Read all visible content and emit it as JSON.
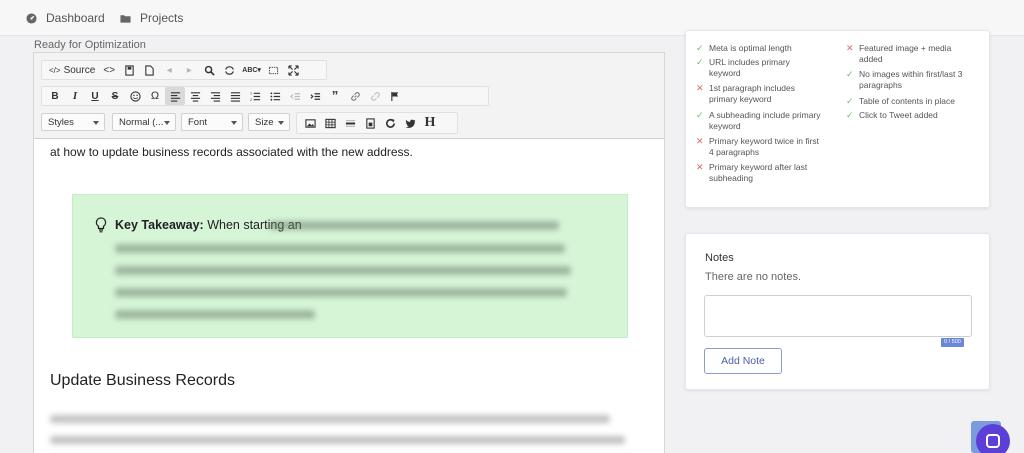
{
  "nav": {
    "dashboard": "Dashboard",
    "projects": "Projects"
  },
  "editor": {
    "status_label": "Ready for Optimization",
    "toolbar": {
      "source_label": "Source",
      "styles_label": "Styles",
      "format_label": "Normal (...",
      "font_label": "Font",
      "size_label": "Size"
    },
    "intro_text": "at how to update business records associated with the new address.",
    "takeaway": {
      "label": "Key Takeaway:",
      "text": "When starting an"
    },
    "heading": "Update Business Records"
  },
  "checklist": {
    "left": [
      {
        "status": "ok",
        "text": "Meta is optimal length"
      },
      {
        "status": "ok",
        "text": "URL includes primary keyword"
      },
      {
        "status": "fail",
        "text": "1st paragraph includes primary keyword"
      },
      {
        "status": "ok",
        "text": "A subheading include primary keyword"
      },
      {
        "status": "fail",
        "text": "Primary keyword twice in first 4 paragraphs"
      },
      {
        "status": "fail",
        "text": "Primary keyword after last subheading"
      }
    ],
    "right": [
      {
        "status": "fail",
        "text": "Featured image + media added"
      },
      {
        "status": "ok",
        "text": "No images within first/last 3 paragraphs"
      },
      {
        "status": "ok",
        "text": "Table of contents in place"
      },
      {
        "status": "ok",
        "text": "Click to Tweet added"
      }
    ]
  },
  "notes": {
    "title": "Notes",
    "empty_text": "There are no notes.",
    "counter": "0 / 500",
    "add_label": "Add Note"
  },
  "colors": {
    "takeaway_bg": "#d6f5d7",
    "accent": "#5b3fd6",
    "fail": "#e06666",
    "ok": "#6bbf6b"
  }
}
